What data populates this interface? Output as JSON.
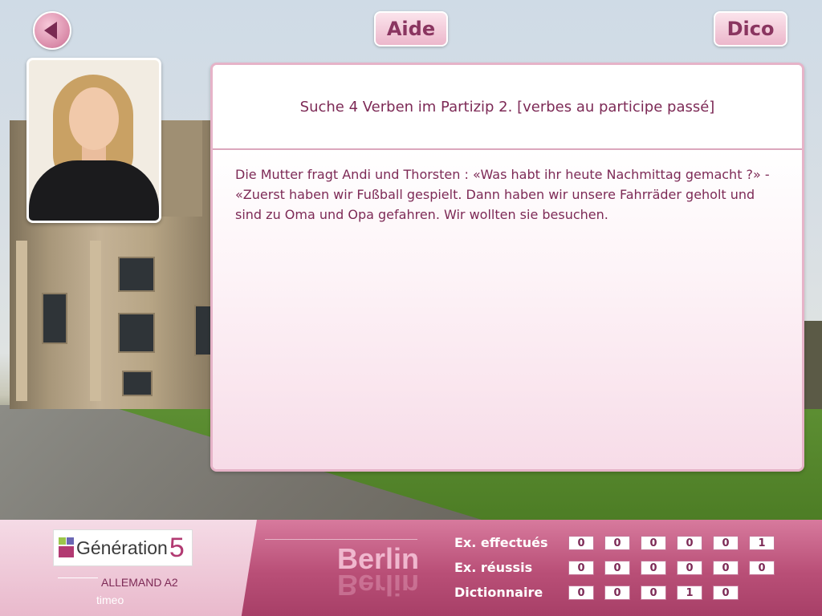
{
  "header": {
    "back_label": "",
    "help_label": "Aide",
    "dictionary_label": "Dico"
  },
  "exercise": {
    "instruction": "Suche 4 Verben im Partizip 2. [verbes au participe passé]",
    "text": "Die Mutter fragt Andi und Thorsten : «Was habt ihr heute Nachmittag gemacht ?» - «Zuerst haben wir Fußball gespielt. Dann haben wir unsere Fahrräder geholt und sind zu Oma und Opa gefahren. Wir wollten sie besuchen."
  },
  "footer": {
    "logo_text": "Génération",
    "logo_number": "5",
    "level": "ALLEMAND A2",
    "brand": "timeo",
    "city": "Berlin",
    "stats": [
      {
        "label": "Ex. effectués",
        "digits": [
          "0",
          "0",
          "0",
          "0",
          "0",
          "1"
        ]
      },
      {
        "label": "Ex. réussis",
        "digits": [
          "0",
          "0",
          "0",
          "0",
          "0",
          "0"
        ]
      },
      {
        "label": "Dictionnaire",
        "digits": [
          "0",
          "0",
          "0",
          "1",
          "0"
        ]
      }
    ]
  },
  "colors": {
    "accent": "#7d2a56",
    "panel_border": "#e6b3c8",
    "footer": "#b94f77"
  },
  "icons": {
    "back": "triangle-left-icon",
    "avatar": "student-photo"
  }
}
